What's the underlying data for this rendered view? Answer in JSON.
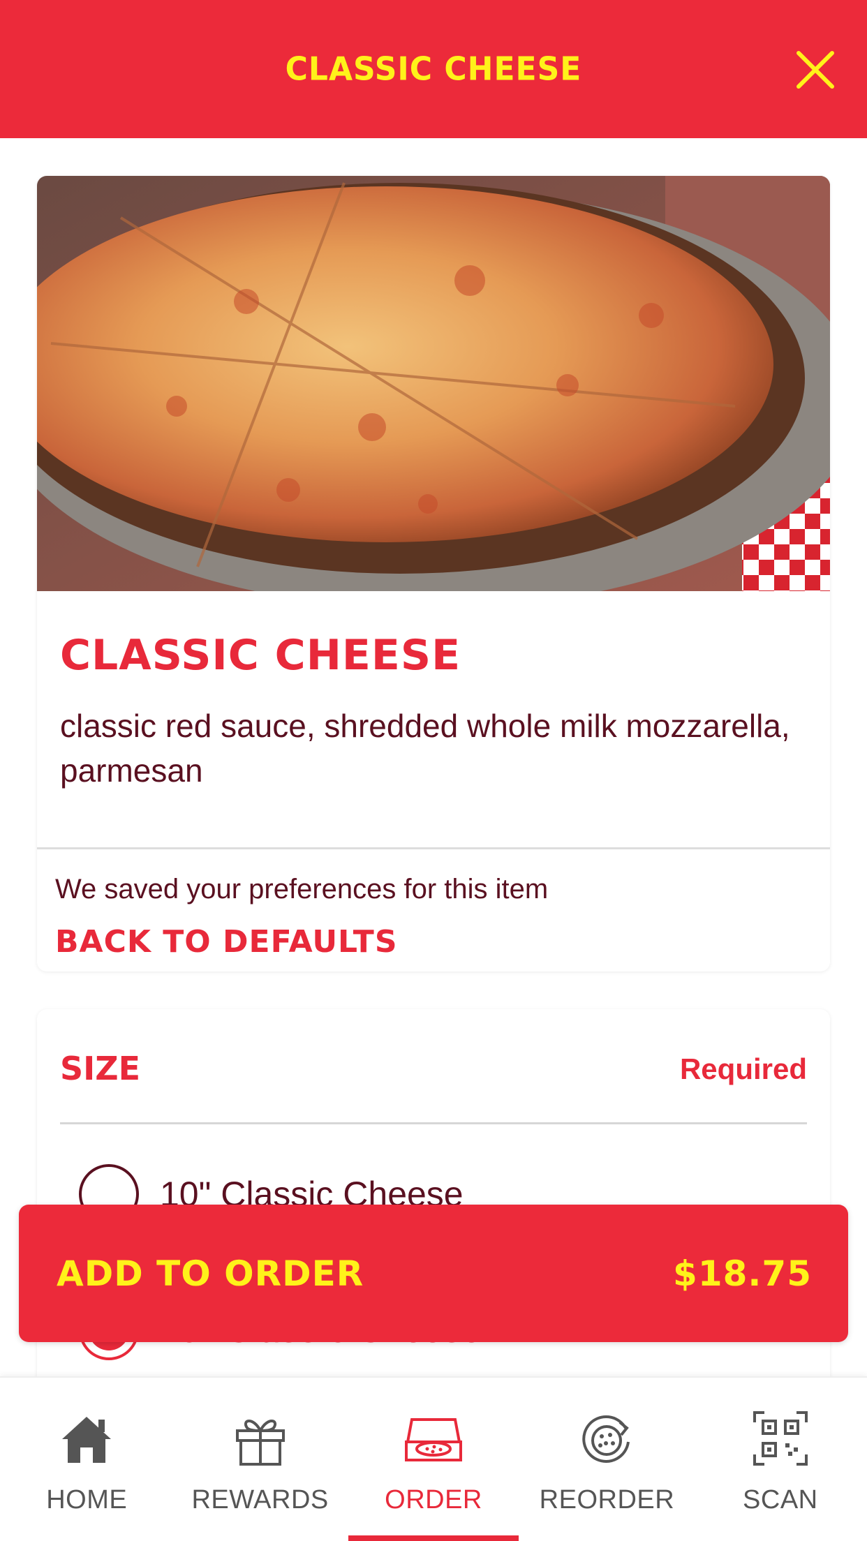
{
  "header": {
    "title": "CLASSIC CHEESE"
  },
  "item": {
    "title": "CLASSIC CHEESE",
    "description": "classic red sauce, shredded whole milk mozzarella, parmesan",
    "preferences_note": "We saved your preferences for this item",
    "back_to_defaults": "BACK TO DEFAULTS"
  },
  "size": {
    "title": "SIZE",
    "required": "Required",
    "options": [
      {
        "label": "10\" Classic Cheese",
        "selected": false
      },
      {
        "label": "16\" Classic Cheese",
        "selected": true
      }
    ]
  },
  "add_to_order": {
    "label": "ADD TO ORDER",
    "price": "$18.75"
  },
  "tabbar": {
    "tabs": [
      {
        "label": "HOME",
        "icon": "home-icon",
        "active": false
      },
      {
        "label": "REWARDS",
        "icon": "gift-icon",
        "active": false
      },
      {
        "label": "ORDER",
        "icon": "pizza-box-icon",
        "active": true
      },
      {
        "label": "REORDER",
        "icon": "reorder-pizza-icon",
        "active": false
      },
      {
        "label": "SCAN",
        "icon": "qr-code-icon",
        "active": false
      }
    ]
  },
  "colors": {
    "brand_red": "#ec2a3a",
    "brand_yellow": "#fff21a",
    "text_maroon": "#5a1020",
    "tab_gray": "#555555"
  }
}
